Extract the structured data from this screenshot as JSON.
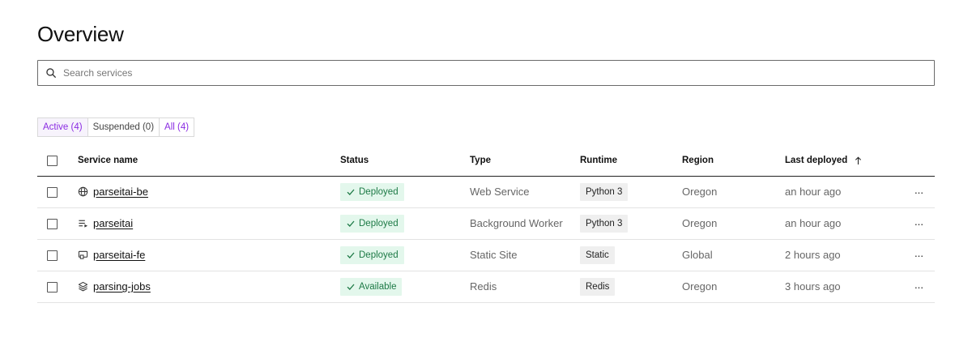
{
  "page": {
    "title": "Overview"
  },
  "search": {
    "placeholder": "Search services",
    "icon": "search-icon"
  },
  "filters": [
    {
      "label": "Active (4)"
    },
    {
      "label": "Suspended (0)"
    },
    {
      "label": "All (4)"
    }
  ],
  "columns": {
    "name": "Service name",
    "status": "Status",
    "type": "Type",
    "runtime": "Runtime",
    "region": "Region",
    "last_deployed": "Last deployed"
  },
  "rows": [
    {
      "icon": "globe-icon",
      "name": "parseitai-be",
      "status": "Deployed",
      "type": "Web Service",
      "runtime": "Python 3",
      "region": "Oregon",
      "last_deployed": "an hour ago"
    },
    {
      "icon": "worker-icon",
      "name": "parseitai",
      "status": "Deployed",
      "type": "Background Worker",
      "runtime": "Python 3",
      "region": "Oregon",
      "last_deployed": "an hour ago"
    },
    {
      "icon": "static-site-icon",
      "name": "parseitai-fe",
      "status": "Deployed",
      "type": "Static Site",
      "runtime": "Static",
      "region": "Global",
      "last_deployed": "2 hours ago"
    },
    {
      "icon": "layers-icon",
      "name": "parsing-jobs",
      "status": "Available",
      "type": "Redis",
      "runtime": "Redis",
      "region": "Oregon",
      "last_deployed": "3 hours ago"
    }
  ],
  "more_label": "···",
  "colors": {
    "accent": "#8a2be2",
    "status_bg": "#e3f7ec",
    "status_fg": "#1d7a46",
    "runtime_bg": "#efefef"
  }
}
